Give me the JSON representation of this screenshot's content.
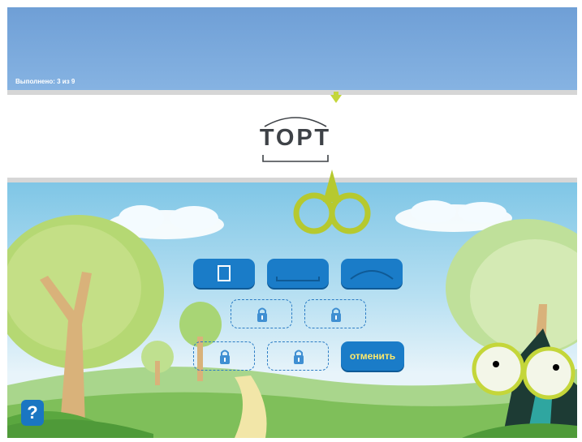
{
  "header": {
    "progress_text": "Выполнено: 3 из 9"
  },
  "word": {
    "text": "ТОРТ"
  },
  "actions": {
    "undo_label": "отменить",
    "help_label": "?"
  },
  "colors": {
    "button_blue": "#1a7cc8",
    "undo_text": "#ffe96b",
    "accent_green": "#c4d63a"
  },
  "icons": {
    "cut_buttons": [
      "square-icon",
      "bracket-icon",
      "arc-icon"
    ],
    "locked_slot": "lock-icon",
    "scissors": "scissors-icon"
  }
}
